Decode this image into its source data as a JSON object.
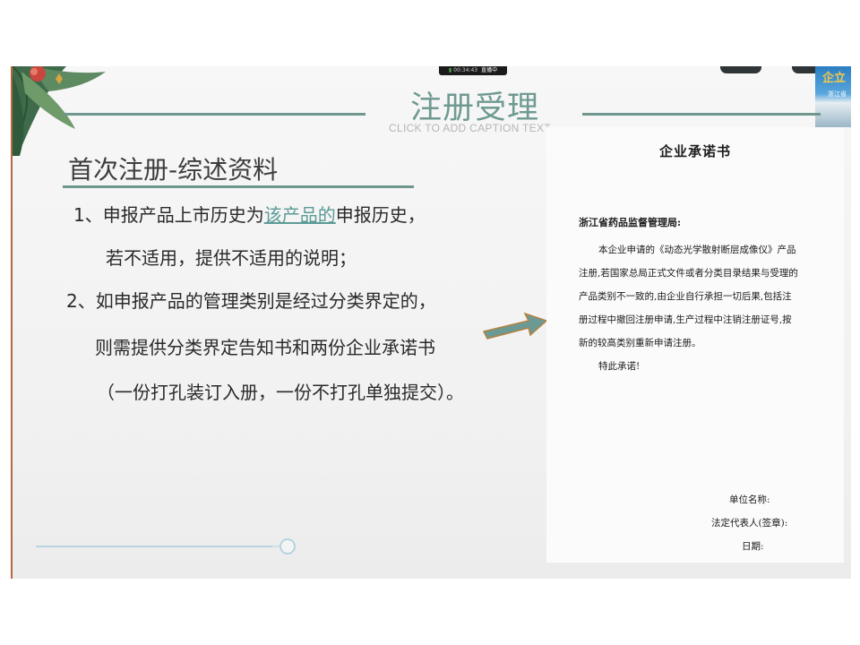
{
  "player": {
    "live_timer": "00:34:43",
    "live_status": "直播中",
    "thumbnail_text": "企立",
    "thumbnail_subtext": "浙江省"
  },
  "slide": {
    "title": "注册受理",
    "caption_placeholder": "CLICK TO ADD CAPTION TEXT",
    "section_heading": "首次注册-综述资料",
    "lines": {
      "l1_pre": "1、申报产品上市历史为",
      "l1_highlight": "该产品的",
      "l1_post": "申报历史，",
      "l2": "若不适用，提供不适用的说明；",
      "l3": "2、如申报产品的管理类别是经过分类界定的，",
      "l4": "则需提供分类界定告知书和两份企业承诺书",
      "l5": "（一份打孔装订入册，一份不打孔单独提交）。"
    },
    "progress": 0.95,
    "colors": {
      "accent": "#6f978e",
      "highlight": "#5b9b96",
      "arrow": "#6b9a95"
    }
  },
  "document": {
    "title": "企业承诺书",
    "addressee": "浙江省药品监督管理局:",
    "body_lines": [
      "本企业申请的《动态光学散射断层成像仪》产品",
      "注册,若国家总局正式文件或者分类目录结果与受理的",
      "产品类别不一致的,由企业自行承担一切后果,包括注",
      "册过程中撤回注册申请,生产过程中注销注册证号,按",
      "新的较高类别重新申请注册。",
      "特此承诺!"
    ],
    "sign_unit": "单位名称:",
    "sign_rep": "法定代表人(签章):",
    "sign_date": "日期:"
  }
}
